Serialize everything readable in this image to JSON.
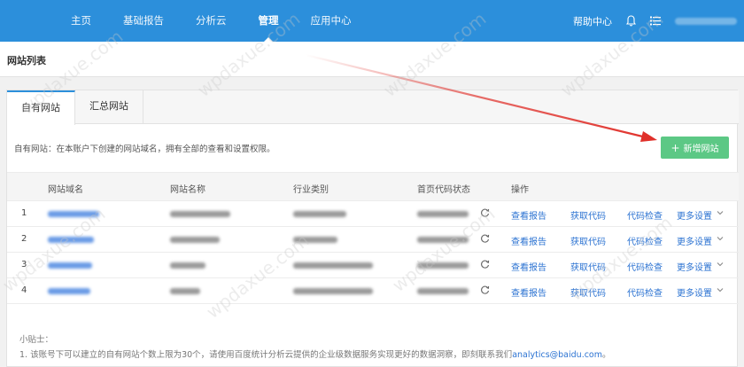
{
  "nav": {
    "items": [
      {
        "label": "主页"
      },
      {
        "label": "基础报告"
      },
      {
        "label": "分析云"
      },
      {
        "label": "管理"
      },
      {
        "label": "应用中心"
      }
    ],
    "active_index": 3,
    "help_label": "帮助中心"
  },
  "page": {
    "title": "网站列表"
  },
  "tabs": [
    {
      "label": "自有网站"
    },
    {
      "label": "汇总网站"
    }
  ],
  "description": "自有网站：在本账户下创建的网站域名，拥有全部的查看和设置权限。",
  "add_button": {
    "label": "新增网站"
  },
  "table": {
    "headers": {
      "domain": "网站域名",
      "name": "网站名称",
      "industry": "行业类别",
      "code_status": "首页代码状态",
      "actions": "操作"
    },
    "rows": [
      {
        "index": "1"
      },
      {
        "index": "2"
      },
      {
        "index": "3"
      },
      {
        "index": "4"
      }
    ],
    "action_labels": {
      "view_report": "查看报告",
      "get_code": "获取代码",
      "check_code": "代码检查",
      "more_settings": "更多设置"
    }
  },
  "tips": {
    "title": "小贴士：",
    "text_prefix": "1. 该账号下可以建立的自有网站个数上限为30个，请使用百度统计分析云提供的企业级数据服务实现更好的数据洞察，即刻联系我们",
    "email": "analytics@baidu.com",
    "text_suffix": "。"
  },
  "watermark": "wpdaxue.com WordPress大学",
  "colors": {
    "topbar": "#2c8fdb",
    "add_button": "#5cc885",
    "link": "#2c73d2",
    "arrow": "#e0302a"
  }
}
